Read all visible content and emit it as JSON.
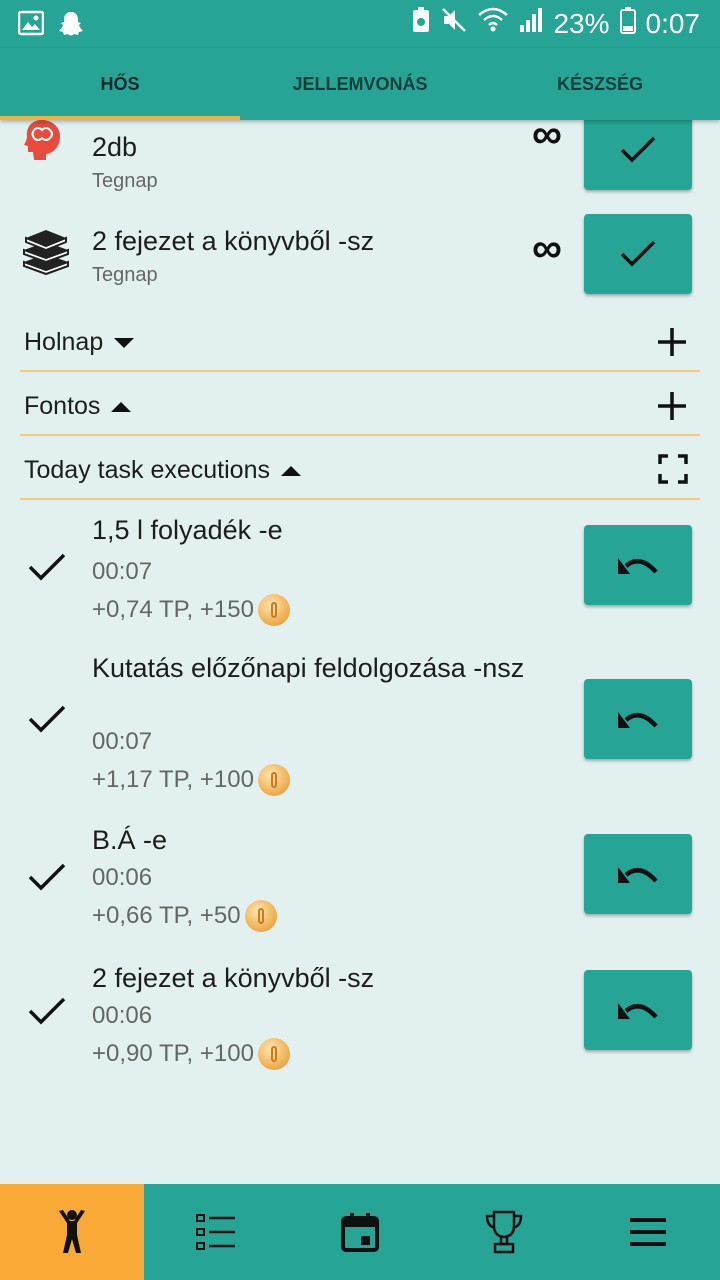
{
  "status": {
    "battery_percent": "23%",
    "time": "0:07",
    "left_icons": [
      "gallery-icon",
      "snapchat-icon"
    ],
    "right_icons": [
      "battery-saver-icon",
      "mute-icon",
      "wifi-icon",
      "signal-icon",
      "battery-icon"
    ]
  },
  "tabs": [
    {
      "label": "HŐS",
      "active": true
    },
    {
      "label": "JELLEMVONÁS",
      "active": false
    },
    {
      "label": "KÉSZSÉG",
      "active": false
    }
  ],
  "tasks": [
    {
      "title": "2db",
      "subtitle": "Tegnap",
      "icon": "brain-head-icon",
      "repeat_symbol": "∞"
    },
    {
      "title": "2 fejezet a könyvből -sz",
      "subtitle": "Tegnap",
      "icon": "books-icon",
      "repeat_symbol": "∞"
    }
  ],
  "sections": [
    {
      "label": "Holnap",
      "expanded": false,
      "action": "plus-icon"
    },
    {
      "label": "Fontos",
      "expanded": true,
      "action": "plus-icon"
    },
    {
      "label": "Today task executions",
      "expanded": true,
      "action": "fullscreen-icon"
    }
  ],
  "executions": [
    {
      "title": "1,5 l folyadék -e",
      "time": "00:07",
      "reward": "+0,74 TP, +150"
    },
    {
      "title": "Kutatás előzőnapi feldolgozása -nsz",
      "time": "00:07",
      "reward": "+1,17 TP, +100"
    },
    {
      "title": "B.Á -e",
      "time": "00:06",
      "reward": "+0,66 TP, +50"
    },
    {
      "title": "2 fejezet a könyvből -sz",
      "time": "00:06",
      "reward": "+0,90 TP, +100"
    }
  ],
  "bottom_nav": [
    {
      "icon": "hero-figure-icon",
      "active": true
    },
    {
      "icon": "task-list-icon",
      "active": false
    },
    {
      "icon": "calendar-icon",
      "active": false
    },
    {
      "icon": "trophy-icon",
      "active": false
    },
    {
      "icon": "menu-icon",
      "active": false
    }
  ],
  "colors": {
    "primary": "#26a597",
    "accent": "#f9a935",
    "background": "#e2f1f0",
    "divider": "#f3c97c"
  }
}
